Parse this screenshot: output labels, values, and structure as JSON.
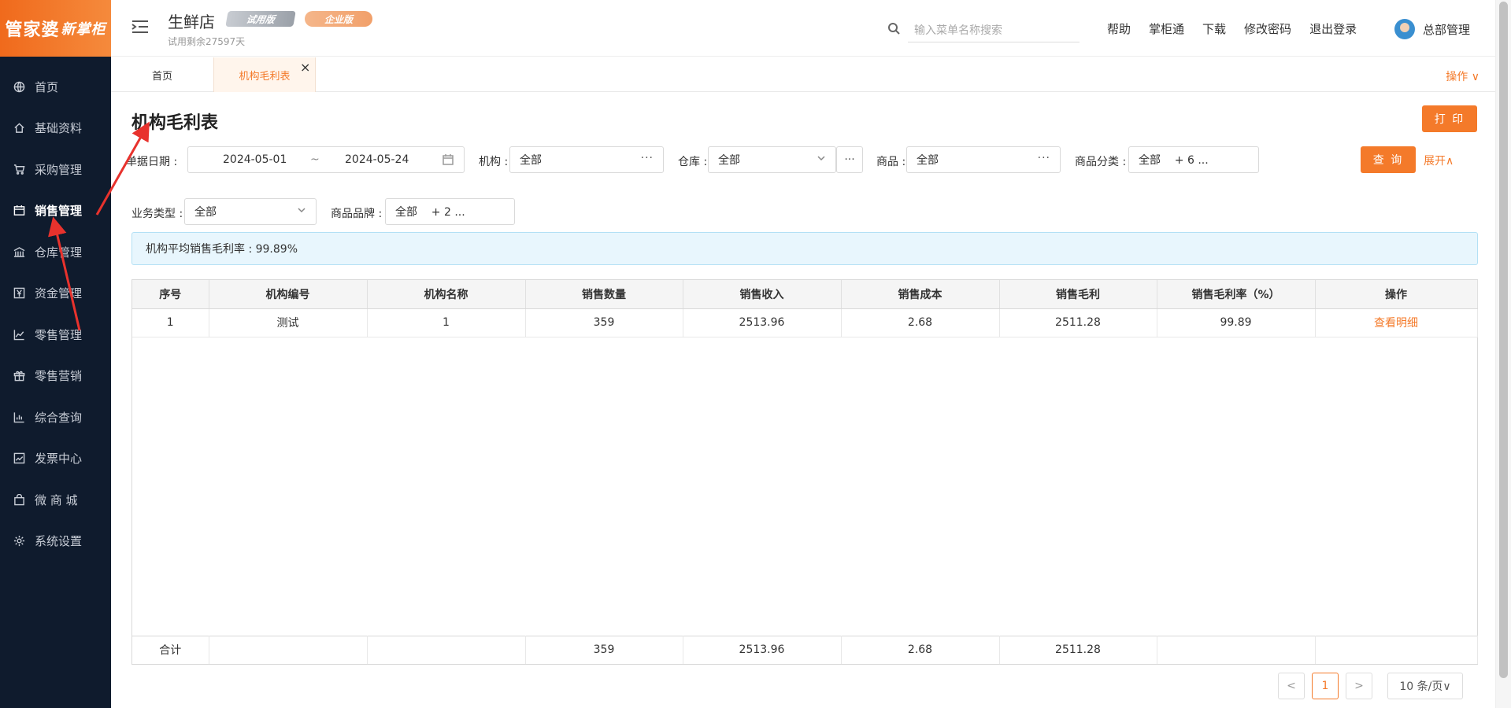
{
  "logo": {
    "main": "管家婆",
    "sub": "新掌柜"
  },
  "sidebar": {
    "items": [
      {
        "label": "首页",
        "icon": "globe-icon"
      },
      {
        "label": "基础资料",
        "icon": "home-icon"
      },
      {
        "label": "采购管理",
        "icon": "cart-icon"
      },
      {
        "label": "销售管理",
        "icon": "calendar-icon",
        "active": true
      },
      {
        "label": "仓库管理",
        "icon": "bank-icon"
      },
      {
        "label": "资金管理",
        "icon": "yen-icon"
      },
      {
        "label": "零售管理",
        "icon": "chart-line-icon"
      },
      {
        "label": "零售营销",
        "icon": "gift-icon"
      },
      {
        "label": "综合查询",
        "icon": "bar-chart-icon"
      },
      {
        "label": "发票中心",
        "icon": "trend-icon"
      },
      {
        "label": "微 商 城",
        "icon": "bag-icon"
      },
      {
        "label": "系统设置",
        "icon": "gear-icon"
      }
    ]
  },
  "header": {
    "shop_name": "生鲜店",
    "trial_badge": "试用版",
    "edition_badge": "企业版",
    "trial_days": "试用剩余27597天",
    "search_placeholder": "输入菜单名称搜索",
    "links": [
      "帮助",
      "掌柜通",
      "下载",
      "修改密码",
      "退出登录"
    ],
    "user_name": "总部管理"
  },
  "tabs": {
    "home": "首页",
    "current": "机构毛利表",
    "close": "×",
    "ops": "操作 ∨"
  },
  "page": {
    "title": "机构毛利表",
    "print_label": "打 印",
    "query_label": "查 询",
    "expand_label": "展开∧"
  },
  "filters": {
    "date_label": "单据日期 :",
    "date_start": "2024-05-01",
    "date_sep": "~",
    "date_end": "2024-05-24",
    "org_label": "机构 :",
    "org_value": "全部",
    "warehouse_label": "仓库 :",
    "warehouse_value": "全部",
    "goods_label": "商品 :",
    "goods_value": "全部",
    "category_label": "商品分类 :",
    "category_value": "全部    + 6 ...",
    "biz_type_label": "业务类型 :",
    "biz_type_value": "全部",
    "brand_label": "商品品牌 :",
    "brand_value": "全部    + 2 ...",
    "dots": "···"
  },
  "info": {
    "text": "机构平均销售毛利率 : 99.89%"
  },
  "table": {
    "headers": [
      "序号",
      "机构编号",
      "机构名称",
      "销售数量",
      "销售收入",
      "销售成本",
      "销售毛利",
      "销售毛利率（%）",
      "操作"
    ],
    "rows": [
      [
        "1",
        "测试",
        "1",
        "359",
        "2513.96",
        "2.68",
        "2511.28",
        "99.89",
        "查看明细"
      ]
    ],
    "footer": [
      "合计",
      "",
      "",
      "359",
      "2513.96",
      "2.68",
      "2511.28",
      "",
      ""
    ]
  },
  "pagination": {
    "prev": "<",
    "current": "1",
    "next": ">",
    "page_size": "10 条/页∨"
  }
}
